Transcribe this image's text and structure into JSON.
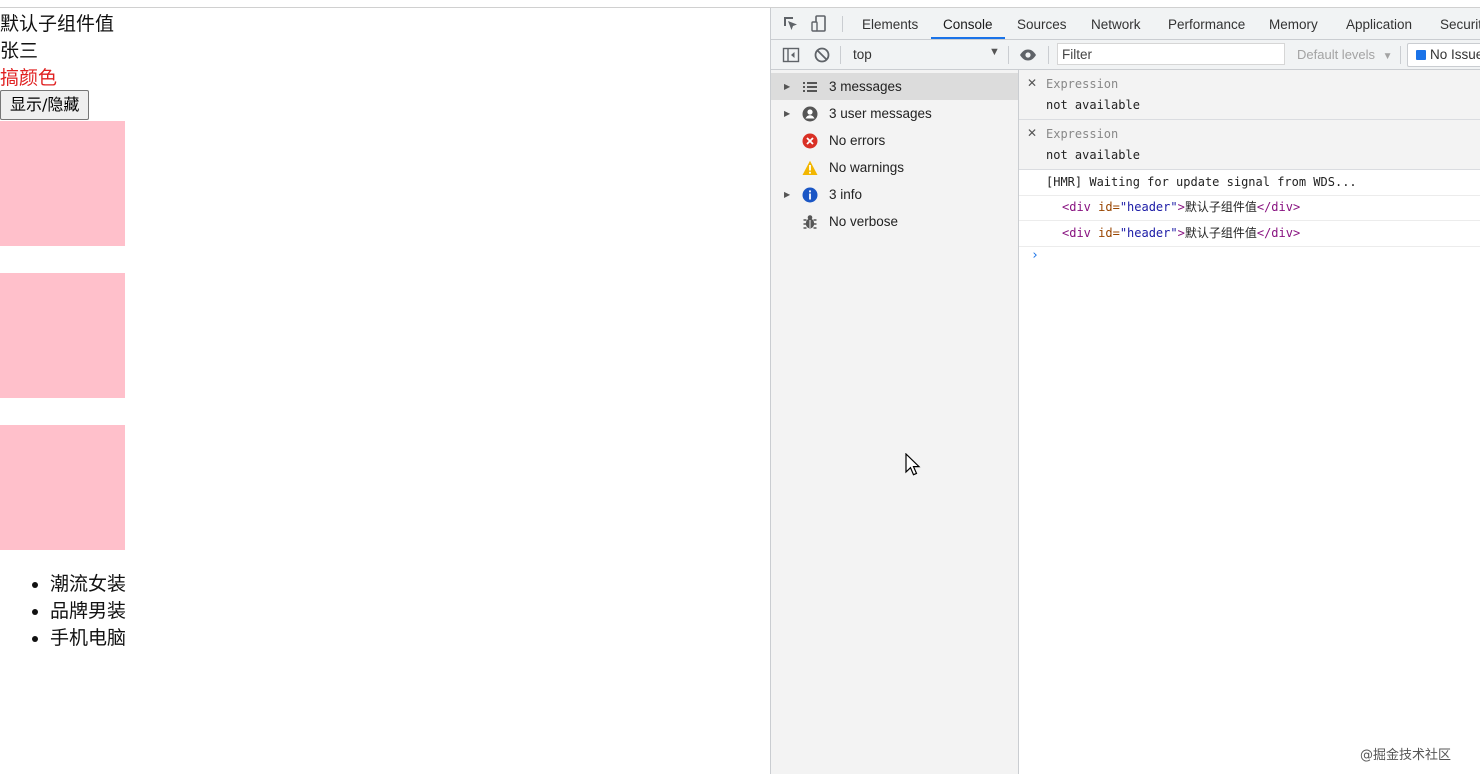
{
  "app": {
    "header_text": "默认子组件值",
    "name_text": "张三",
    "color_text": "搞颜色",
    "toggle_button_label": "显示/隐藏",
    "box_color": "#ffc0cb",
    "categories": [
      "潮流女装",
      "品牌男装",
      "手机电脑"
    ]
  },
  "devtools": {
    "tabs": [
      "Elements",
      "Console",
      "Sources",
      "Network",
      "Performance",
      "Memory",
      "Application",
      "Securit"
    ],
    "active_tab": "Console",
    "toolbar": {
      "context": "top",
      "filter_placeholder": "Filter",
      "levels": "Default levels",
      "issues_label": "No Issue"
    },
    "sidebar": {
      "items": [
        {
          "label": "3 messages",
          "icon": "list-icon"
        },
        {
          "label": "3 user messages",
          "icon": "user-icon"
        },
        {
          "label": "No errors",
          "icon": "error-icon"
        },
        {
          "label": "No warnings",
          "icon": "warning-icon"
        },
        {
          "label": "3 info",
          "icon": "info-icon"
        },
        {
          "label": "No verbose",
          "icon": "bug-icon"
        }
      ]
    },
    "console": {
      "expressions": [
        {
          "name": "Expression",
          "value": "not available"
        },
        {
          "name": "Expression",
          "value": "not available"
        }
      ],
      "logs": {
        "hmr": "[HMR] Waiting for update signal from WDS...",
        "div1": {
          "open": "<div",
          "attr": " id=",
          "attr_value": "\"header\"",
          "close_bracket": ">",
          "text": "默认子组件值",
          "end_tag": "</div>"
        },
        "div2": {
          "open": "<div",
          "attr": " id=",
          "attr_value": "\"header\"",
          "close_bracket": ">",
          "text": "默认子组件值",
          "end_tag": "</div>"
        }
      },
      "prompt": "›"
    }
  },
  "watermark": "@掘金技术社区",
  "colors": {
    "accent": "#1a73e8",
    "error": "#d93025",
    "warning": "#f2b600",
    "info": "#1a56c5"
  }
}
